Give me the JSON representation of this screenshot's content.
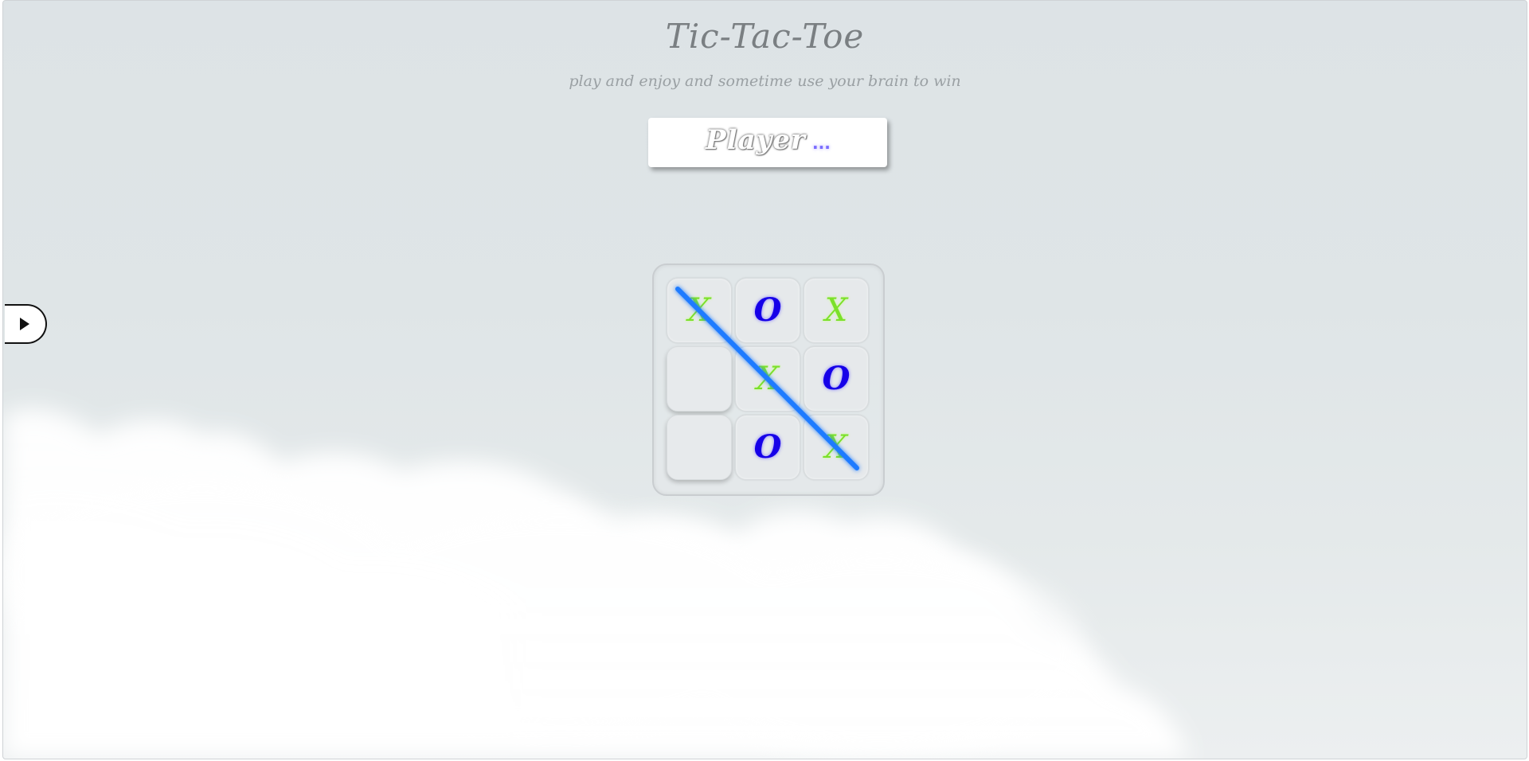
{
  "header": {
    "title": "Tic-Tac-Toe",
    "subtitle": "play and enjoy and sometime use your brain to win"
  },
  "status": {
    "player_label": "Player",
    "current_player": "..."
  },
  "board": {
    "cells": [
      "X",
      "O",
      "X",
      "",
      "X",
      "O",
      "",
      "O",
      "X"
    ],
    "winning_cells": [
      0,
      4,
      8
    ],
    "colors": {
      "x": "#7be02a",
      "o": "#1600e8",
      "win_line": "#1e7bff"
    }
  },
  "side_panel": {
    "toggle_icon": "play-triangle-icon"
  }
}
